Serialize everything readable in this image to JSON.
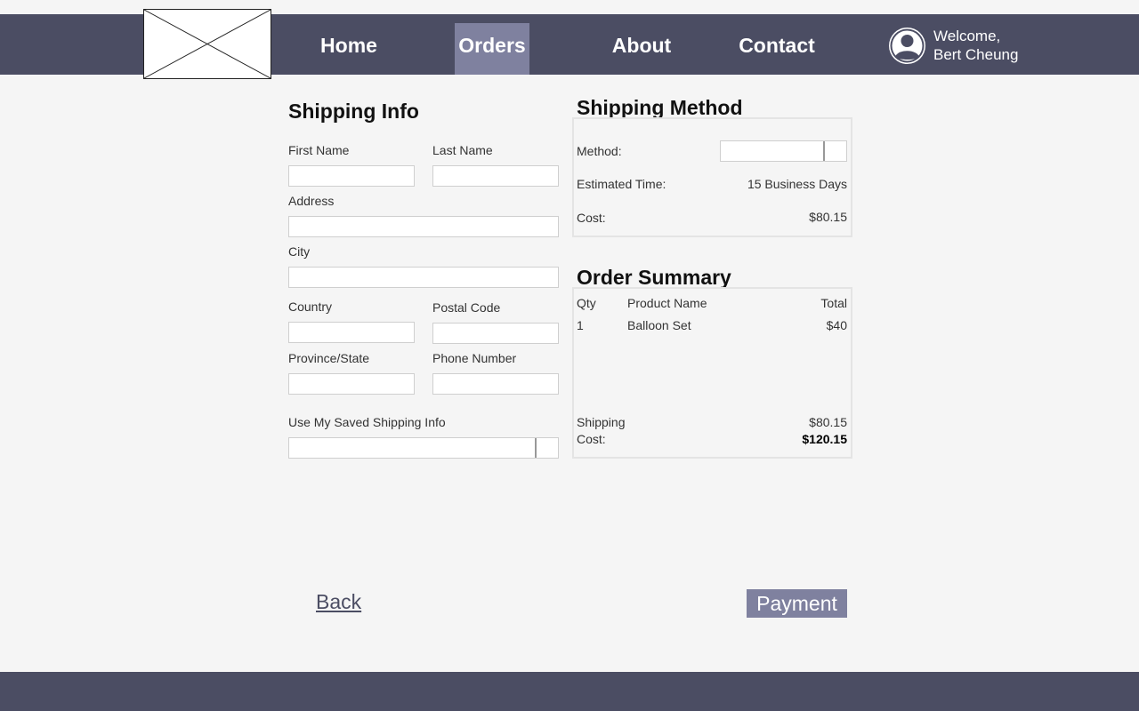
{
  "nav": {
    "items": [
      "Home",
      "Orders",
      "About",
      "Contact"
    ],
    "active": "Orders",
    "welcome_line1": "Welcome,",
    "welcome_line2": "Bert Cheung"
  },
  "shipping_info": {
    "title": "Shipping Info",
    "first_name_label": "First Name",
    "last_name_label": "Last Name",
    "address_label": "Address",
    "city_label": "City",
    "country_label": "Country",
    "postal_code_label": "Postal Code",
    "province_label": "Province/State",
    "phone_label": "Phone Number",
    "saved_label": "Use My Saved Shipping Info"
  },
  "shipping_method": {
    "title": "Shipping Method",
    "method_label": "Method:",
    "estimated_label": "Estimated Time:",
    "estimated_value": "15 Business Days",
    "cost_label": "Cost:",
    "cost_value": "$80.15"
  },
  "order_summary": {
    "title": "Order Summary",
    "headers": [
      "Qty",
      "Product Name",
      "Total"
    ],
    "rows": [
      {
        "qty": "1",
        "product": "Balloon Set",
        "total": "$40"
      }
    ],
    "shipping_label": "Shipping",
    "shipping_value": "$80.15",
    "cost_label": "Cost:",
    "cost_value": "$120.15"
  },
  "actions": {
    "back_label": "Back",
    "payment_label": "Payment"
  },
  "colors": {
    "header_bg": "#4b4d63",
    "accent": "#7f819f",
    "page_bg": "#f5f5f5"
  }
}
